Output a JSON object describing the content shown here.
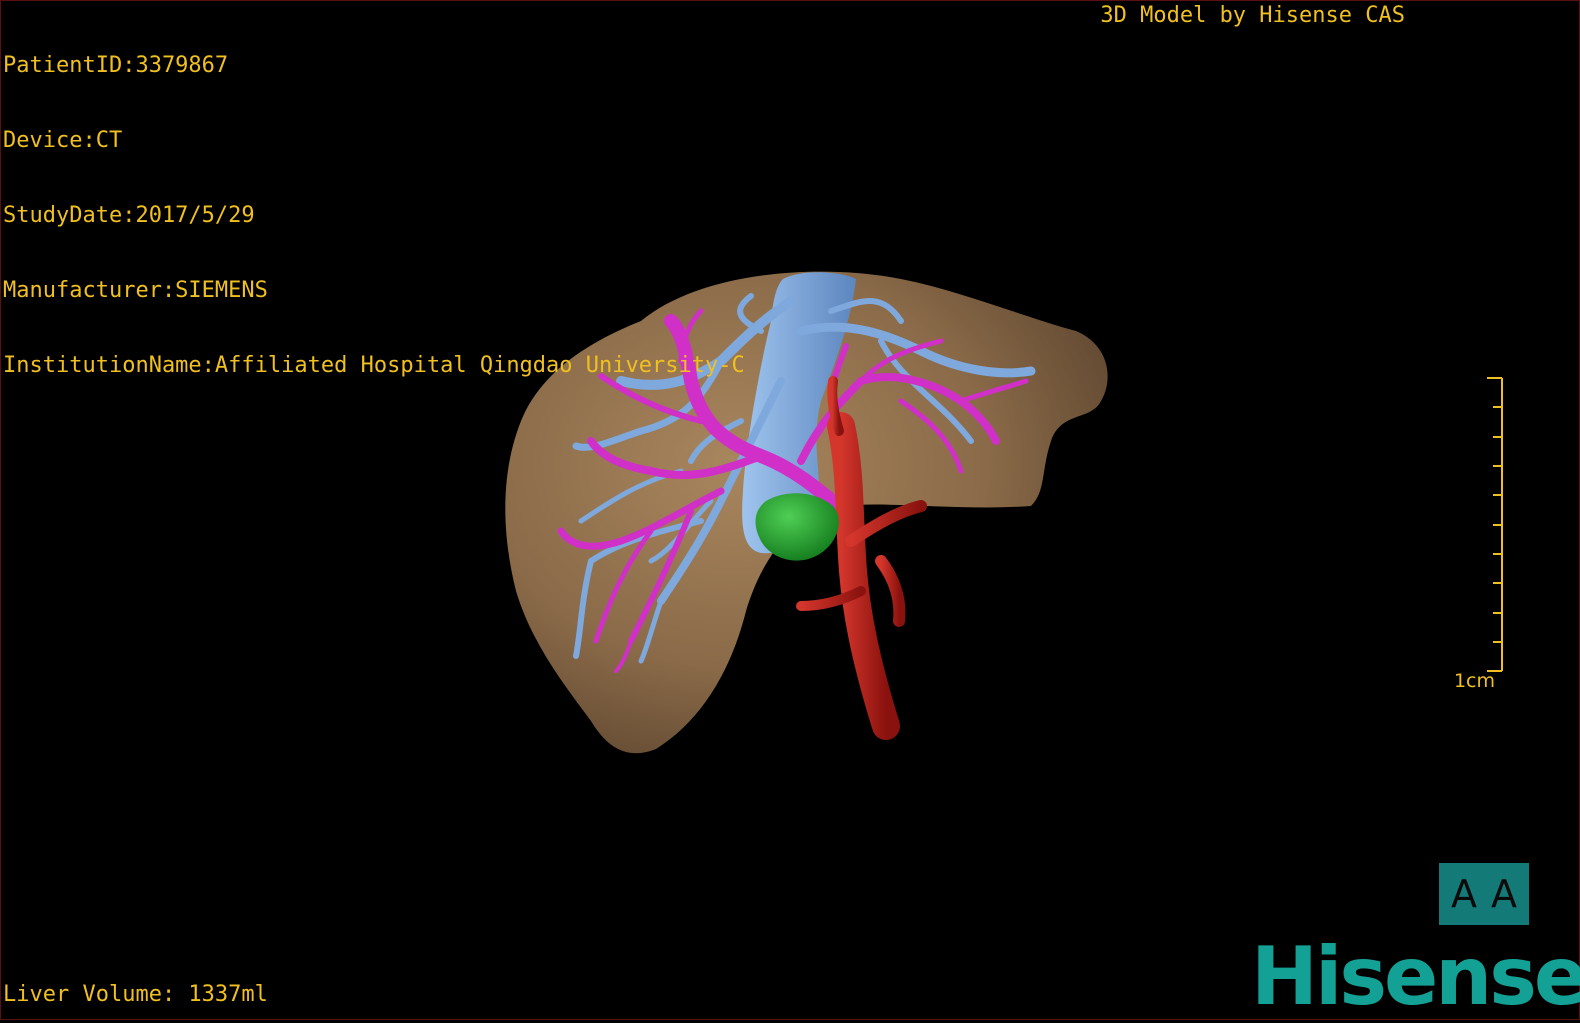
{
  "meta": {
    "patient_id": "PatientID:3379867",
    "device": "Device:CT",
    "study_date": "StudyDate:2017/5/29",
    "manufacturer": "Manufacturer:SIEMENS",
    "institution": "InstitutionName:Affiliated Hospital Qingdao University-C"
  },
  "model_credit": "3D Model by Hisense CAS",
  "liver_volume": "Liver Volume: 1337ml",
  "scale_bar": {
    "label": "1cm"
  },
  "orientation": {
    "left_letter": "A",
    "right_letter": "A"
  },
  "brand": "Hisense",
  "colors": {
    "overlay_text": "#f0c020",
    "liver": "#8a6a48",
    "hepatic_vein": "#7fa8dc",
    "portal_vein": "#d030c8",
    "artery": "#b01a14",
    "lesion": "#1f9a2a",
    "brand": "#14a195",
    "orientation_cube": "#137a78"
  },
  "icons": {
    "orientation_cube": "orientation-cube-icon",
    "brand_logo": "hisense-logo"
  }
}
